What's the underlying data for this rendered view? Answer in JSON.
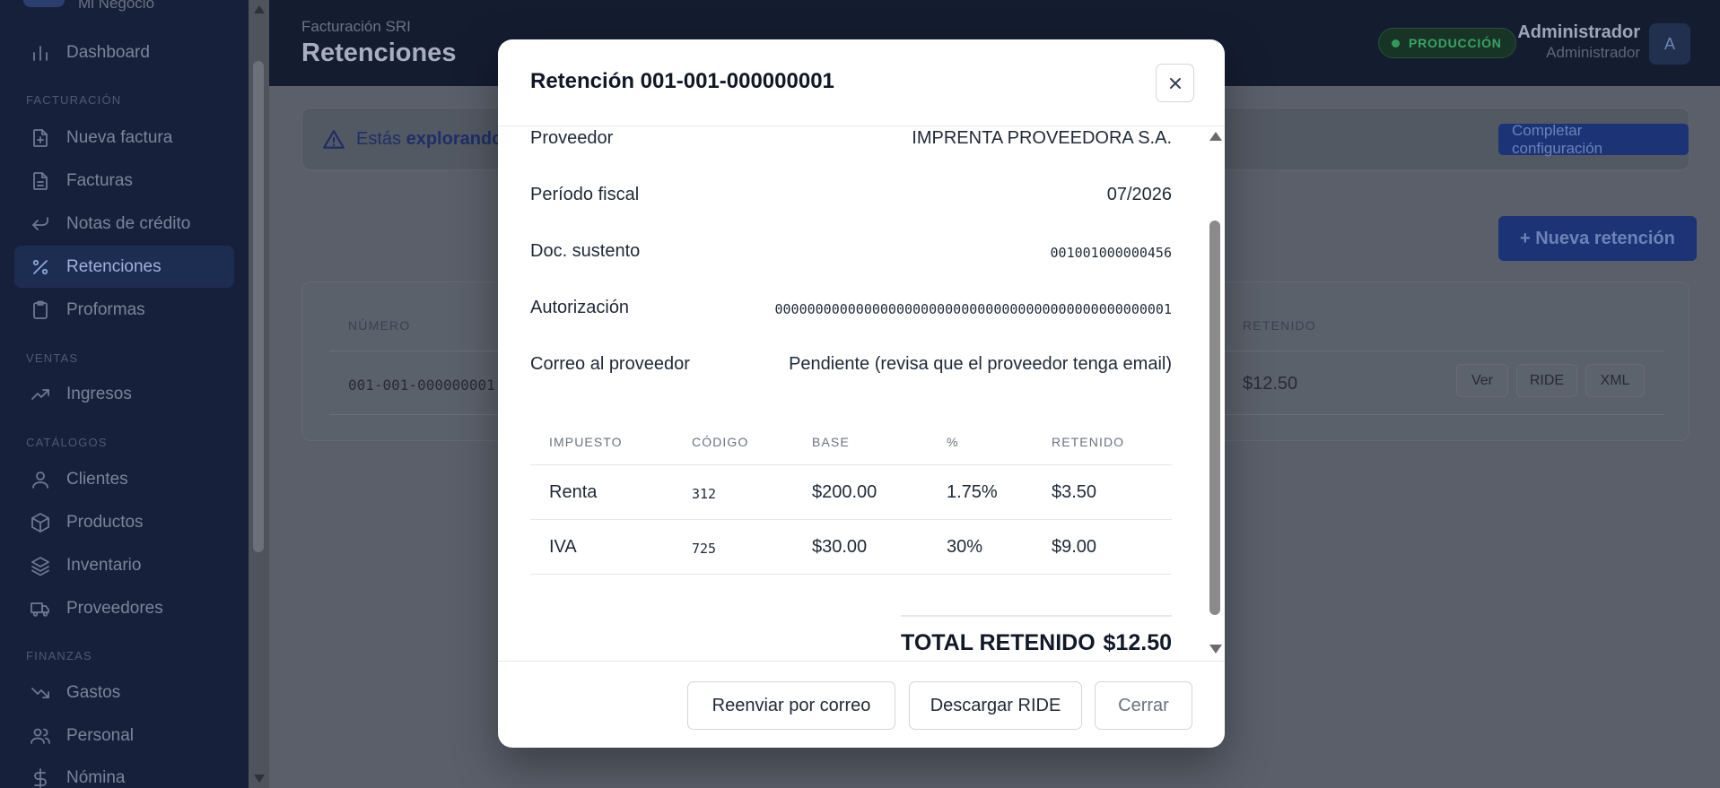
{
  "brand": {
    "name": "Mi Negocio"
  },
  "sidebar": {
    "sections": [
      "FACTURACIÓN",
      "VENTAS",
      "CATÁLOGOS",
      "FINANZAS"
    ],
    "items": [
      {
        "label": "Dashboard",
        "icon": "bar-chart-icon"
      },
      {
        "label": "Nueva factura",
        "icon": "file-plus-icon"
      },
      {
        "label": "Facturas",
        "icon": "file-text-icon"
      },
      {
        "label": "Notas de crédito",
        "icon": "return-arrow-icon"
      },
      {
        "label": "Retenciones",
        "icon": "percent-icon",
        "active": true
      },
      {
        "label": "Proformas",
        "icon": "clipboard-icon"
      },
      {
        "label": "Ingresos",
        "icon": "trending-up-icon"
      },
      {
        "label": "Clientes",
        "icon": "user-icon"
      },
      {
        "label": "Productos",
        "icon": "box-icon"
      },
      {
        "label": "Inventario",
        "icon": "layers-icon"
      },
      {
        "label": "Proveedores",
        "icon": "truck-icon"
      },
      {
        "label": "Gastos",
        "icon": "trending-down-icon"
      },
      {
        "label": "Personal",
        "icon": "users-icon"
      },
      {
        "label": "Nómina",
        "icon": "dollar-icon"
      }
    ]
  },
  "header": {
    "breadcrumb": "Facturación SRI",
    "title": "Retenciones",
    "environment": "PRODUCCIÓN",
    "user_name": "Administrador",
    "user_role": "Administrador",
    "avatar_initial": "A"
  },
  "main": {
    "alert_prefix": "Estás ",
    "alert_bold": "explorando",
    "config_button": "Completar configuración",
    "new_button": "+ Nueva retención",
    "table": {
      "col_numero": "NÚMERO",
      "col_retenido": "RETENIDO",
      "row": {
        "numero": "001-001-000000001",
        "retenido": "$12.50"
      },
      "actions": [
        "Ver",
        "RIDE",
        "XML"
      ]
    }
  },
  "modal": {
    "title": "Retención 001-001-000000001",
    "fields": [
      {
        "label": "Proveedor",
        "value": "IMPRENTA PROVEEDORA S.A."
      },
      {
        "label": "Período fiscal",
        "value": "07/2026"
      },
      {
        "label": "Doc. sustento",
        "value": "001001000000456"
      },
      {
        "label": "Autorización",
        "value": "0000000000000000000000000000000000000000000000001"
      },
      {
        "label": "Correo al proveedor",
        "value": "Pendiente (revisa que el proveedor tenga email)"
      }
    ],
    "table": {
      "headers": [
        "IMPUESTO",
        "CÓDIGO",
        "BASE",
        "%",
        "RETENIDO"
      ],
      "rows": [
        [
          "Renta",
          "312",
          "$200.00",
          "1.75%",
          "$3.50"
        ],
        [
          "IVA",
          "725",
          "$30.00",
          "30%",
          "$9.00"
        ]
      ]
    },
    "total_label": "TOTAL RETENIDO",
    "total_value": "$12.50",
    "buttons": {
      "resend": "Reenviar por correo",
      "download": "Descargar RIDE",
      "close": "Cerrar"
    }
  }
}
